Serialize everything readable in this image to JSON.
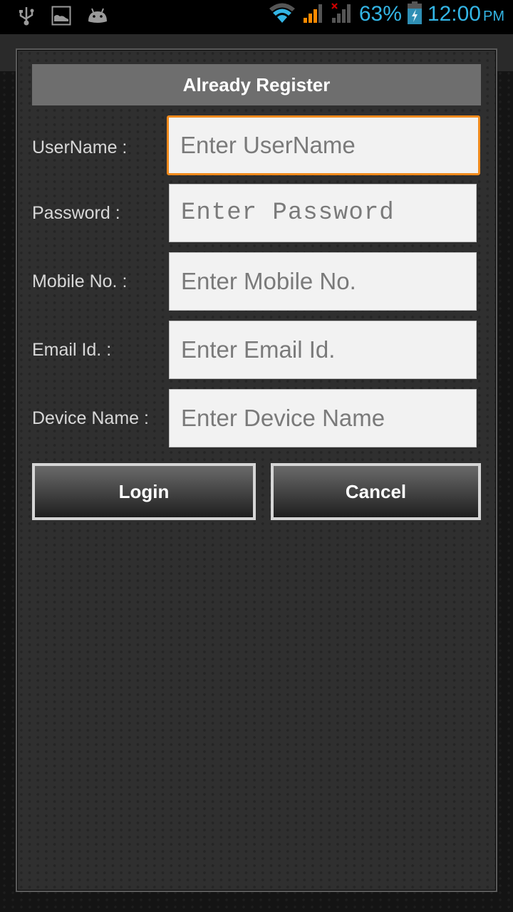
{
  "status_bar": {
    "left_icons": [
      "usb-icon",
      "image-notification-icon",
      "android-debug-icon"
    ],
    "right_icons": [
      "wifi-icon",
      "cell-signal-icon",
      "no-sim-signal-icon",
      "battery-charging-icon"
    ],
    "battery_percent": "63%",
    "time": "12:00",
    "ampm": "PM",
    "accent_color": "#33b5e5"
  },
  "dialog": {
    "title": "Already Register",
    "fields": [
      {
        "label": "UserName :",
        "placeholder": "Enter UserName",
        "value": "",
        "focused": true
      },
      {
        "label": "Password :",
        "placeholder": "Enter Password",
        "value": ""
      },
      {
        "label": "Mobile No. :",
        "placeholder": "Enter Mobile No.",
        "value": ""
      },
      {
        "label": "Email Id. :",
        "placeholder": "Enter Email Id.",
        "value": ""
      },
      {
        "label": "Device Name :",
        "placeholder": "Enter Device Name",
        "value": ""
      }
    ],
    "buttons": {
      "login": "Login",
      "cancel": "Cancel"
    },
    "focus_color": "#f08a1c"
  }
}
